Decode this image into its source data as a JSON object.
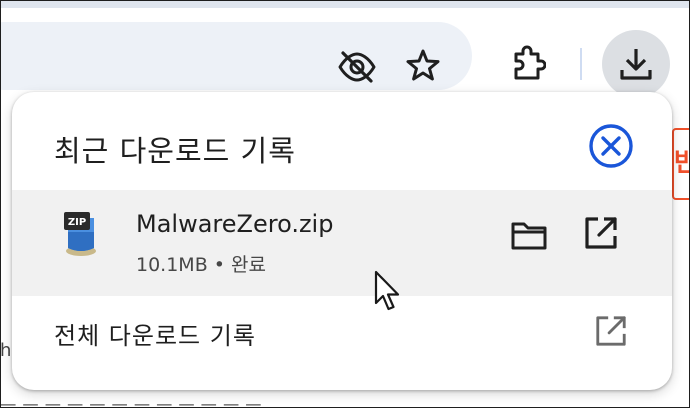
{
  "panel": {
    "title": "최근 다운로드 기록",
    "item": {
      "file_name": "MalwareZero.zip",
      "size": "10.1MB",
      "separator": "•",
      "status": "완료",
      "file_icon_badge": "ZIP"
    },
    "full_history_label": "전체 다운로드 기록"
  },
  "icons": {
    "toolbar": [
      "eye-off-icon",
      "star-icon",
      "extension-puzzle-icon",
      "download-icon"
    ],
    "panel": [
      "close-circle-icon",
      "zip-file-icon",
      "folder-icon",
      "open-in-new-icon",
      "cursor-arrow-icon"
    ]
  },
  "colors": {
    "accent": "#1a56d9",
    "omnibox_bg": "#edf1f7",
    "download_button_bg": "#dcdfe3",
    "row_bg": "#f1f1f1",
    "side_badge": "#f0502b"
  }
}
